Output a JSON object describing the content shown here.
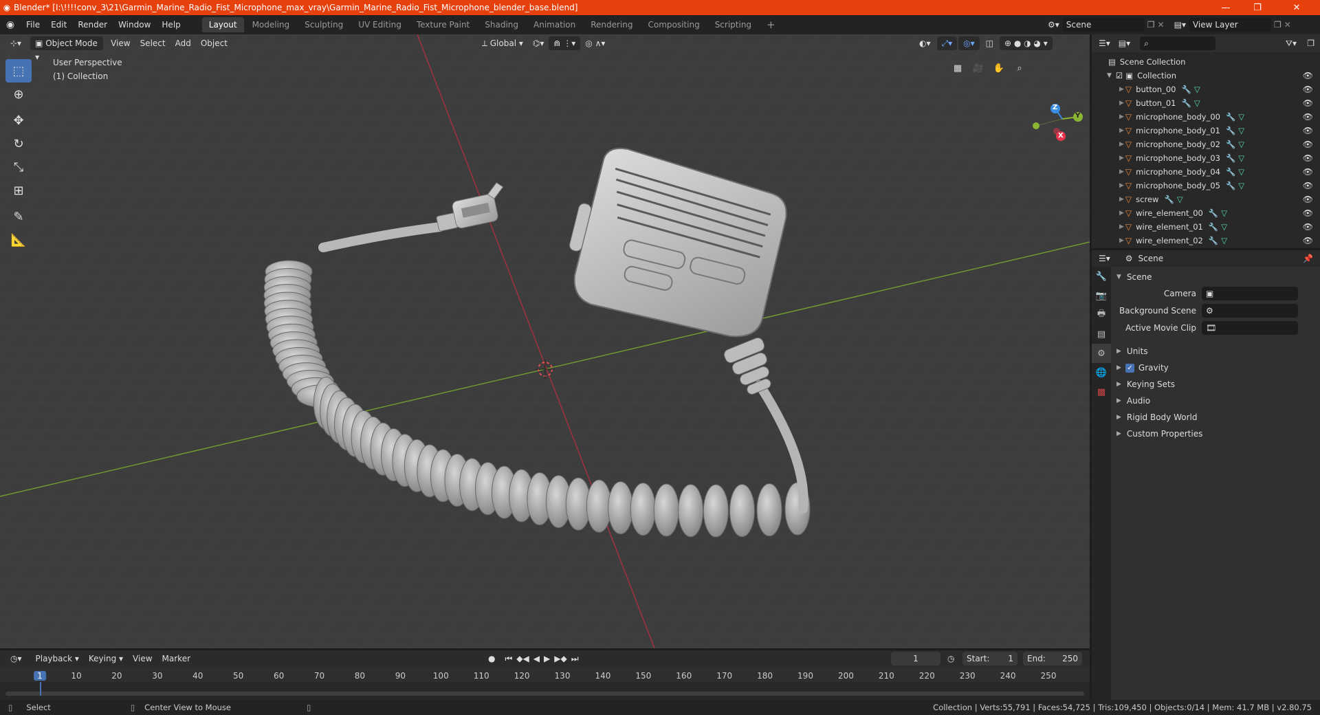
{
  "window": {
    "title": "Blender* [I:\\!!!!conv_3\\21\\Garmin_Marine_Radio_Fist_Microphone_max_vray\\Garmin_Marine_Radio_Fist_Microphone_blender_base.blend]"
  },
  "menu": [
    "File",
    "Edit",
    "Render",
    "Window",
    "Help"
  ],
  "workspaces": [
    "Layout",
    "Modeling",
    "Sculpting",
    "UV Editing",
    "Texture Paint",
    "Shading",
    "Animation",
    "Rendering",
    "Compositing",
    "Scripting"
  ],
  "active_workspace": "Layout",
  "scene_field": "Scene",
  "view_layer_field": "View Layer",
  "viewport": {
    "mode": "Object Mode",
    "menus": [
      "View",
      "Select",
      "Add",
      "Object"
    ],
    "transform_orientation": "Global",
    "perspective_label": "User Perspective",
    "collection_label": "(1) Collection",
    "gizmo_axes": {
      "x": "X",
      "y": "Y",
      "z": "Z"
    }
  },
  "outliner": {
    "root": "Scene Collection",
    "collection": "Collection",
    "objects": [
      "button_00",
      "button_01",
      "microphone_body_00",
      "microphone_body_01",
      "microphone_body_02",
      "microphone_body_03",
      "microphone_body_04",
      "microphone_body_05",
      "screw",
      "wire_element_00",
      "wire_element_01",
      "wire_element_02"
    ]
  },
  "properties": {
    "header": "Scene",
    "panel": "Scene",
    "camera_label": "Camera",
    "background_scene_label": "Background Scene",
    "active_movie_clip_label": "Active Movie Clip",
    "sections": [
      "Units",
      "Gravity",
      "Keying Sets",
      "Audio",
      "Rigid Body World",
      "Custom Properties"
    ],
    "gravity_checked": true
  },
  "timeline": {
    "menus": [
      "Playback",
      "Keying",
      "View",
      "Marker"
    ],
    "current_frame": "1",
    "start_label": "Start:",
    "start": "1",
    "end_label": "End:",
    "end": "250",
    "ticks": [
      "1",
      "10",
      "20",
      "30",
      "40",
      "50",
      "60",
      "70",
      "80",
      "90",
      "100",
      "110",
      "120",
      "130",
      "140",
      "150",
      "160",
      "170",
      "180",
      "190",
      "200",
      "210",
      "220",
      "230",
      "240",
      "250"
    ]
  },
  "statusbar": {
    "select": "Select",
    "center_view": "Center View to Mouse",
    "stats": "Collection | Verts:55,791 | Faces:54,725 | Tris:109,450 | Objects:0/14 | Mem: 41.7 MB | v2.80.75"
  },
  "colors": {
    "title_bar": "#e6400d",
    "accent": "#4772b3",
    "x_axis": "#e8344c",
    "y_axis": "#8ab533",
    "z_axis": "#3a8ee6"
  }
}
